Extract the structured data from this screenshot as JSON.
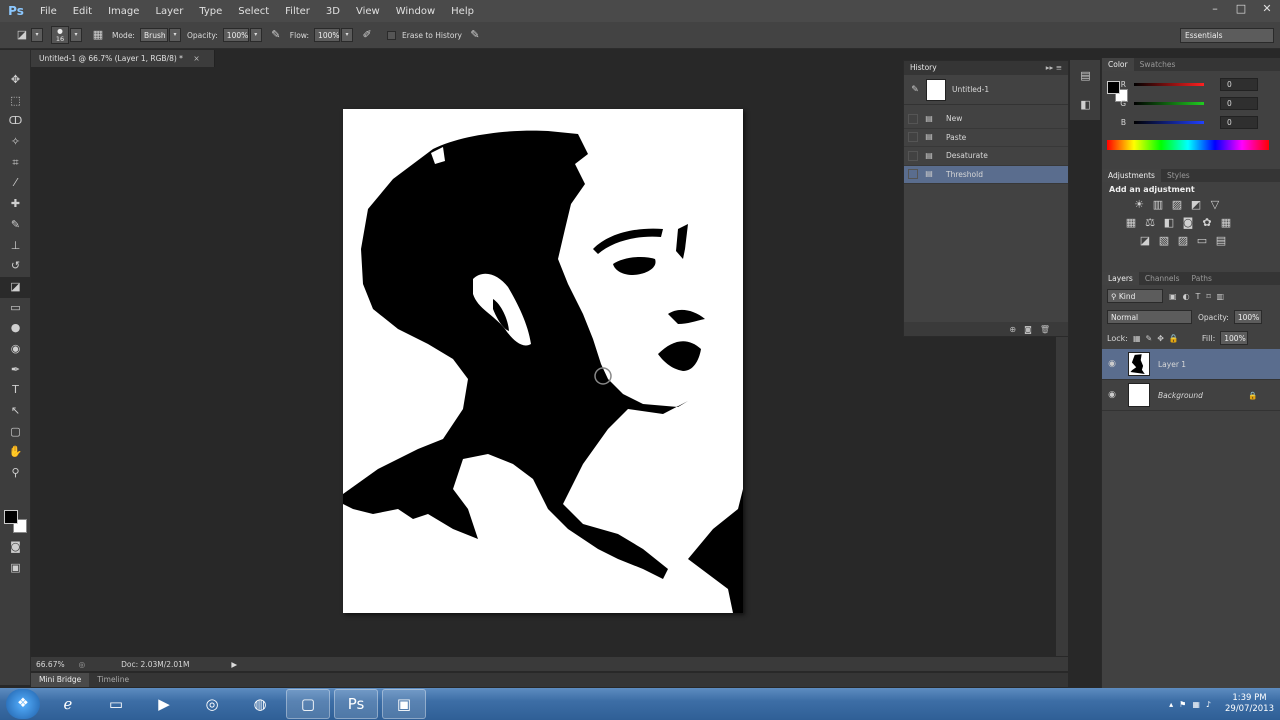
{
  "app": {
    "logo": "Ps",
    "menu": [
      "File",
      "Edit",
      "Image",
      "Layer",
      "Type",
      "Select",
      "Filter",
      "3D",
      "View",
      "Window",
      "Help"
    ],
    "window_buttons": [
      "–",
      "□",
      "✕"
    ]
  },
  "options_bar": {
    "brush_size": "16",
    "mode_label": "Mode:",
    "mode_value": "Brush",
    "opacity_label": "Opacity:",
    "opacity_value": "100%",
    "flow_label": "Flow:",
    "flow_value": "100%",
    "erase_history_label": "Erase to History",
    "workspace": "Essentials"
  },
  "document": {
    "tab_title": "Untitled-1 @ 66.7% (Layer 1, RGB/8) *",
    "tab_close": "×",
    "zoom": "66.67%",
    "doc_info": "Doc: 2.03M/2.01M"
  },
  "bottom_tabs": [
    "Mini Bridge",
    "Timeline"
  ],
  "history": {
    "title": "History",
    "snapshot": "Untitled-1",
    "items": [
      {
        "label": "New",
        "active": false
      },
      {
        "label": "Paste",
        "active": false
      },
      {
        "label": "Desaturate",
        "active": false
      },
      {
        "label": "Threshold",
        "active": true
      }
    ]
  },
  "color_panel": {
    "tabs": [
      "Color",
      "Swatches"
    ],
    "channels": [
      {
        "name": "R",
        "value": "0",
        "color": "#ff2020"
      },
      {
        "name": "G",
        "value": "0",
        "color": "#20cc20"
      },
      {
        "name": "B",
        "value": "0",
        "color": "#2040ff"
      }
    ]
  },
  "adjustments": {
    "tabs": [
      "Adjustments",
      "Styles"
    ],
    "heading": "Add an adjustment"
  },
  "layers": {
    "tabs": [
      "Layers",
      "Channels",
      "Paths"
    ],
    "kind_label": "Kind",
    "blend_mode": "Normal",
    "opacity_label": "Opacity:",
    "opacity_value": "100%",
    "lock_label": "Lock:",
    "fill_label": "Fill:",
    "fill_value": "100%",
    "items": [
      {
        "name": "Layer 1",
        "active": true
      },
      {
        "name": "Background",
        "active": false
      }
    ]
  },
  "taskbar": {
    "time": "1:39 PM",
    "date": "29/07/2013"
  }
}
